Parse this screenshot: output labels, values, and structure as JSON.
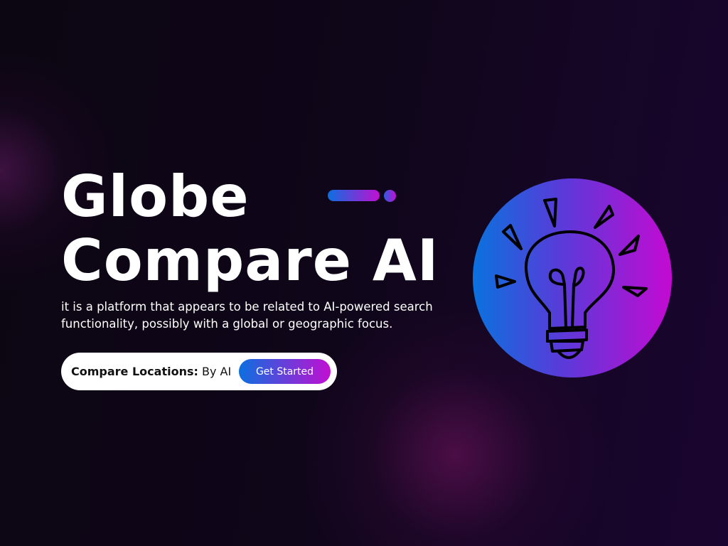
{
  "hero": {
    "title_line1": "Globe",
    "title_line2": "Compare AI",
    "description": " it is a platform that appears to be related to AI-powered search functionality, possibly with a global or geographic focus.",
    "pill": {
      "label_bold": "Compare Locations:",
      "label_rest": " By AI",
      "button_label": "Get Started"
    }
  },
  "illustration": {
    "icon": "lightbulb-icon"
  },
  "colors": {
    "accent_start": "#0b6fe0",
    "accent_end": "#c20fd2",
    "background": "#0f0619"
  }
}
